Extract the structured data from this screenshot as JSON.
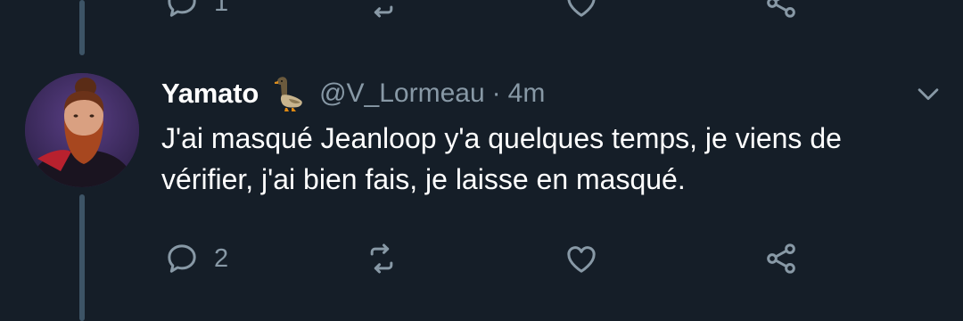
{
  "previous_tweet": {
    "reply_count": "1"
  },
  "tweet": {
    "display_name": "Yamato",
    "badge_emoji": "duck-emoji",
    "handle": "@V_Lormeau",
    "separator": "·",
    "time": "4m",
    "text": "J'ai masqué Jeanloop y'a quelques temps, je viens de\nvérifier, j'ai bien fais, je laisse en masqué.",
    "reply_count": "2"
  },
  "colors": {
    "background": "#151e28",
    "thread_line": "#3d5466",
    "secondary_text": "#8899a6",
    "primary_text": "#ffffff"
  },
  "icons": [
    "reply-icon",
    "retweet-icon",
    "like-icon",
    "share-icon",
    "chevron-down-icon",
    "duck-emoji"
  ]
}
